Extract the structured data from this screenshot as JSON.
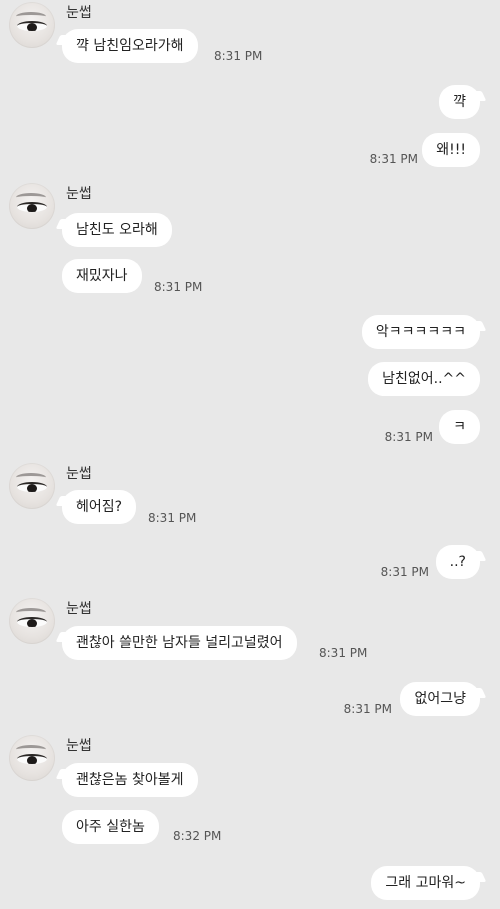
{
  "groups": [
    {
      "sender_name": "눈썹",
      "messages": [
        {
          "text": "꺅 남친임오라가해",
          "time": "8:31 PM"
        }
      ]
    },
    {
      "sender": "me",
      "messages": [
        {
          "text": "꺅",
          "time": ""
        },
        {
          "text": "왜!!!",
          "time": "8:31 PM"
        }
      ]
    },
    {
      "sender_name": "눈썹",
      "messages": [
        {
          "text": "남친도 오라해",
          "time": ""
        },
        {
          "text": "재밌자나",
          "time": "8:31 PM"
        }
      ]
    },
    {
      "sender": "me",
      "messages": [
        {
          "text": "악ㅋㅋㅋㅋㅋㅋ",
          "time": ""
        },
        {
          "text": "남친없어..^^",
          "time": ""
        },
        {
          "text": "ㅋ",
          "time": "8:31 PM"
        }
      ]
    },
    {
      "sender_name": "눈썹",
      "messages": [
        {
          "text": "헤어짐?",
          "time": "8:31 PM"
        }
      ]
    },
    {
      "sender": "me",
      "messages": [
        {
          "text": "..?",
          "time": "8:31 PM"
        }
      ]
    },
    {
      "sender_name": "눈썹",
      "messages": [
        {
          "text": "괜찮아 쓸만한 남자들 널리고널렸어",
          "time": "8:31 PM"
        }
      ]
    },
    {
      "sender": "me",
      "messages": [
        {
          "text": "없어그냥",
          "time": "8:31 PM"
        }
      ]
    },
    {
      "sender_name": "눈썹",
      "messages": [
        {
          "text": "괜찮은놈 찾아볼게",
          "time": ""
        },
        {
          "text": "아주 실한놈",
          "time": "8:32 PM"
        }
      ]
    },
    {
      "sender": "me",
      "messages": [
        {
          "text": "그래 고마워~",
          "time": ""
        }
      ]
    }
  ]
}
